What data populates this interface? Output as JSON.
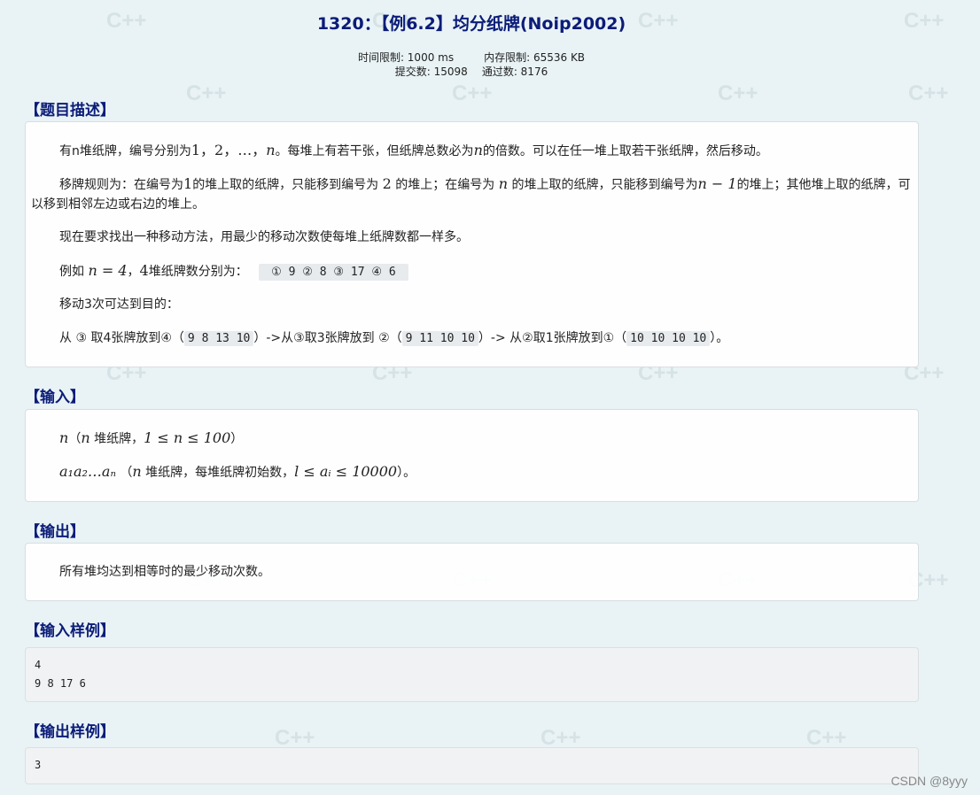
{
  "title": "1320：【例6.2】均分纸牌(Noip2002)",
  "meta": {
    "time_limit": "时间限制: 1000 ms",
    "memory_limit": "内存限制: 65536 KB",
    "submissions": "提交数: 15098",
    "accepted": "通过数: 8176"
  },
  "sections": {
    "description": {
      "title": "【题目描述】",
      "p1": {
        "a": "有n堆纸牌，编号分别为",
        "b": "1，2，…，",
        "n": "n",
        "c": "。每堆上有若干张，但纸牌总数必为",
        "n2": "n",
        "d": "的倍数。可以在任一堆上取若干张纸牌，然后移动。"
      },
      "p2": {
        "a": "移牌规则为：在编号为",
        "one": "1",
        "b": "的堆上取的纸牌，只能移到编号为",
        "two": "2",
        "c": "的堆上；在编号为",
        "n": "n",
        "d": "的堆上取的纸牌，只能移到编号为",
        "nm1": "n − 1",
        "e": "的堆上；其他堆上取的纸牌，可以移到相邻左边或右边的堆上。"
      },
      "p3": "现在要求找出一种移动方法，用最少的移动次数使每堆上纸牌数都一样多。",
      "p4": {
        "a": "例如",
        "eq": "n = 4",
        "comma": "，",
        "four": "4",
        "b": "堆纸牌数分别为：",
        "code": " ① 9 ② 8 ③ 17 ④ 6 "
      },
      "p5": "移动3次可达到目的：",
      "p6": {
        "a": "从 ③ 取4张牌放到④（",
        "c1": "9 8 13 10",
        "b": "）->从③取3张牌放到 ②（",
        "c2": "9 11 10 10",
        "c": "）-> 从②取1张牌放到①（",
        "c3": "10 10 10 10",
        "d": "）。"
      }
    },
    "input": {
      "title": "【输入】",
      "l1": {
        "n": "n",
        "a": "（",
        "n2": "n",
        "b": " 堆纸牌，",
        "range": "1 ≤ n ≤ 100",
        "c": "）"
      },
      "l2": {
        "seq": "a₁a₂…aₙ",
        "a": "（",
        "n": "n",
        "b": " 堆纸牌，每堆纸牌初始数，",
        "range": "l ≤ aᵢ ≤ 10000",
        "c": "）。"
      }
    },
    "output": {
      "title": "【输出】",
      "text": "所有堆均达到相等时的最少移动次数。"
    },
    "sample_input": {
      "title": "【输入样例】",
      "lines": [
        "4",
        "9 8 17 6"
      ]
    },
    "sample_output": {
      "title": "【输出样例】",
      "lines": [
        "3"
      ]
    }
  },
  "watermark": {
    "text": "CSDN @8yyy",
    "pattern": "C++"
  }
}
